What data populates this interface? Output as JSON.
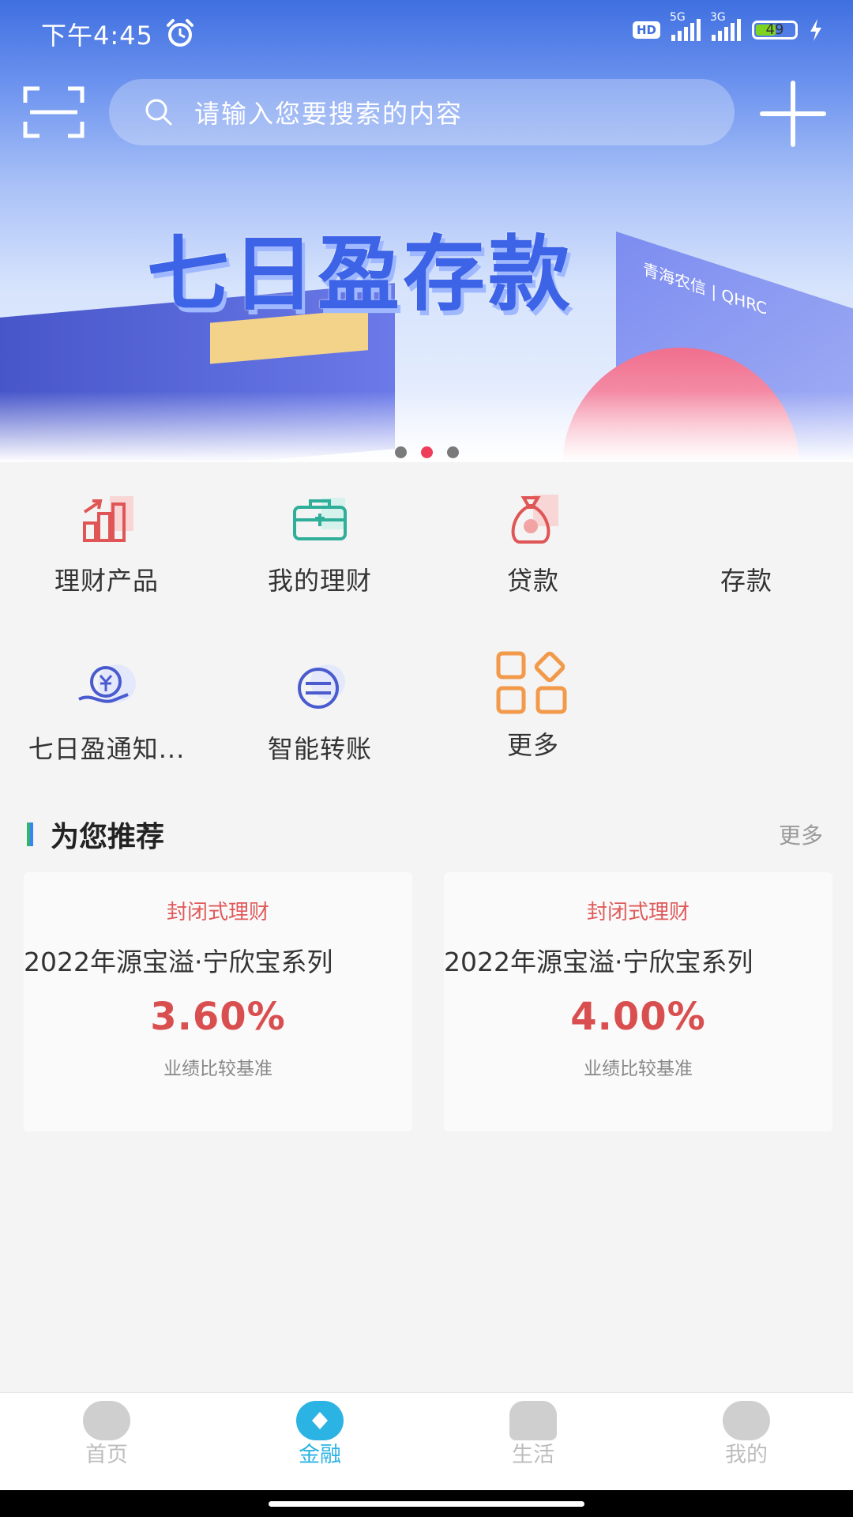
{
  "status": {
    "time": "下午4:45",
    "hd": "HD",
    "net1": "5G",
    "net2": "3G",
    "battery": "49"
  },
  "search": {
    "placeholder": "请输入您要搜索的内容"
  },
  "banner": {
    "headline": "七日盈存款",
    "brand_text": "青海农信 | QHRC",
    "dots_count": 3,
    "active_dot": 1
  },
  "shortcuts": [
    {
      "label": "理财产品",
      "icon": "chart-bars-icon"
    },
    {
      "label": "我的理财",
      "icon": "briefcase-icon"
    },
    {
      "label": "贷款",
      "icon": "money-bag-icon"
    },
    {
      "label": "存款",
      "icon": "deposit-icon"
    },
    {
      "label": "七日盈通知...",
      "icon": "yen-hand-icon"
    },
    {
      "label": "智能转账",
      "icon": "transfer-icon"
    },
    {
      "label": "更多",
      "icon": "grid-more-icon"
    }
  ],
  "recommend": {
    "title": "为您推荐",
    "more": "更多",
    "cards": [
      {
        "category": "封闭式理财",
        "name": "2022年源宝溢·宁欣宝系列",
        "rate": "3.60%",
        "note": "业绩比较基准"
      },
      {
        "category": "封闭式理财",
        "name": "2022年源宝溢·宁欣宝系列",
        "rate": "4.00%",
        "note": "业绩比较基准"
      }
    ]
  },
  "tabs": [
    {
      "label": "首页",
      "active": false
    },
    {
      "label": "金融",
      "active": true
    },
    {
      "label": "生活",
      "active": false
    },
    {
      "label": "我的",
      "active": false
    }
  ],
  "colors": {
    "accent": "#2bb3e3",
    "rate": "#d94f4f",
    "category": "#e05a5a",
    "active_dot": "#ef3e5a"
  }
}
